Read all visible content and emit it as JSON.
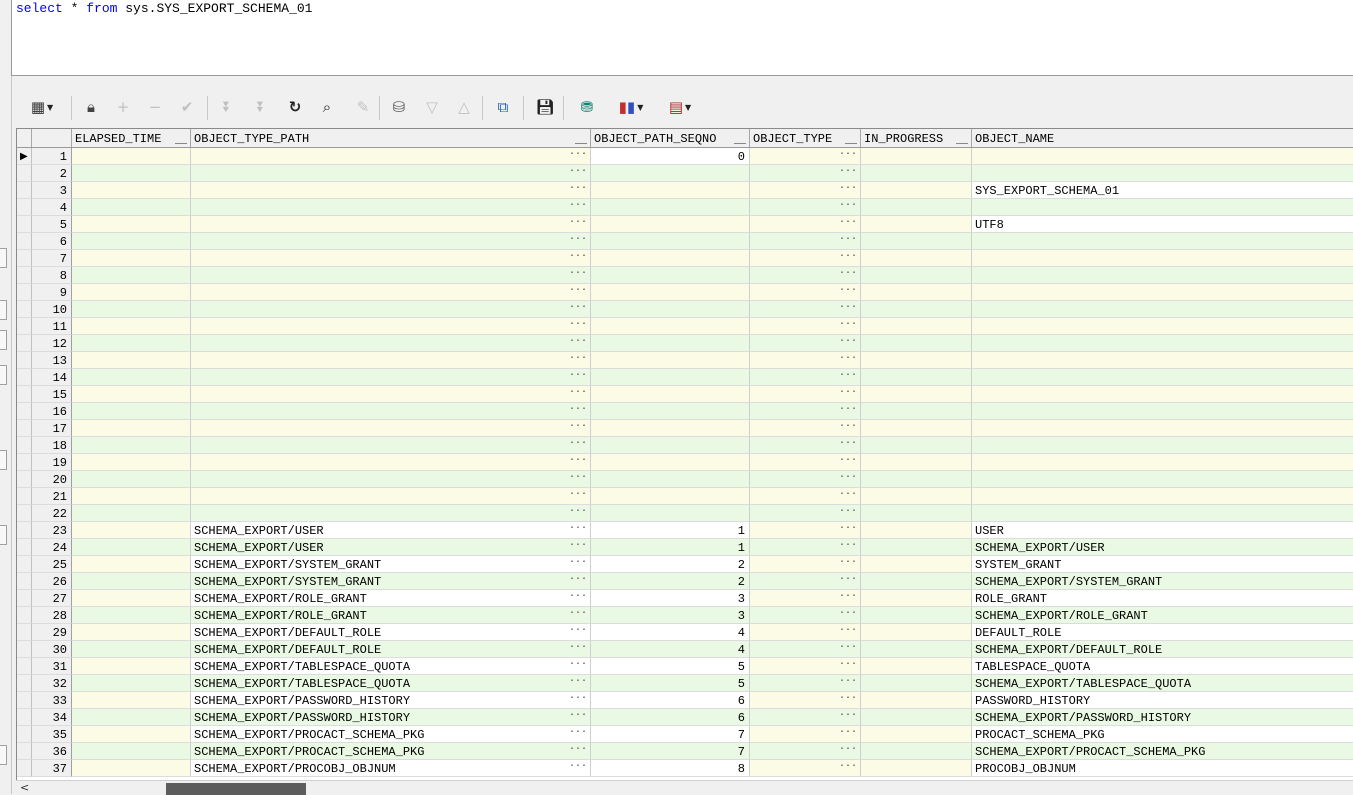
{
  "sql": {
    "keyword_select": "select",
    "star": " * ",
    "keyword_from": "from",
    "table_ref": " sys.SYS_EXPORT_SCHEMA_01"
  },
  "columns": [
    "ELAPSED_TIME",
    "OBJECT_TYPE_PATH",
    "OBJECT_PATH_SEQNO",
    "OBJECT_TYPE",
    "IN_PROGRESS",
    "OBJECT_NAME"
  ],
  "cell_ellipsis": "···",
  "rows": [
    {
      "n": "1",
      "path": "",
      "seq": "0",
      "name": ""
    },
    {
      "n": "2",
      "path": "",
      "seq": "",
      "name": ""
    },
    {
      "n": "3",
      "path": "",
      "seq": "",
      "name": "SYS_EXPORT_SCHEMA_01"
    },
    {
      "n": "4",
      "path": "",
      "seq": "",
      "name": ""
    },
    {
      "n": "5",
      "path": "",
      "seq": "",
      "name": "UTF8"
    },
    {
      "n": "6",
      "path": "",
      "seq": "",
      "name": ""
    },
    {
      "n": "7",
      "path": "",
      "seq": "",
      "name": ""
    },
    {
      "n": "8",
      "path": "",
      "seq": "",
      "name": ""
    },
    {
      "n": "9",
      "path": "",
      "seq": "",
      "name": ""
    },
    {
      "n": "10",
      "path": "",
      "seq": "",
      "name": ""
    },
    {
      "n": "11",
      "path": "",
      "seq": "",
      "name": ""
    },
    {
      "n": "12",
      "path": "",
      "seq": "",
      "name": ""
    },
    {
      "n": "13",
      "path": "",
      "seq": "",
      "name": ""
    },
    {
      "n": "14",
      "path": "",
      "seq": "",
      "name": ""
    },
    {
      "n": "15",
      "path": "",
      "seq": "",
      "name": ""
    },
    {
      "n": "16",
      "path": "",
      "seq": "",
      "name": ""
    },
    {
      "n": "17",
      "path": "",
      "seq": "",
      "name": ""
    },
    {
      "n": "18",
      "path": "",
      "seq": "",
      "name": ""
    },
    {
      "n": "19",
      "path": "",
      "seq": "",
      "name": ""
    },
    {
      "n": "20",
      "path": "",
      "seq": "",
      "name": ""
    },
    {
      "n": "21",
      "path": "",
      "seq": "",
      "name": ""
    },
    {
      "n": "22",
      "path": "",
      "seq": "",
      "name": ""
    },
    {
      "n": "23",
      "path": "SCHEMA_EXPORT/USER",
      "seq": "1",
      "name": "USER"
    },
    {
      "n": "24",
      "path": "SCHEMA_EXPORT/USER",
      "seq": "1",
      "name": "SCHEMA_EXPORT/USER"
    },
    {
      "n": "25",
      "path": "SCHEMA_EXPORT/SYSTEM_GRANT",
      "seq": "2",
      "name": "SYSTEM_GRANT"
    },
    {
      "n": "26",
      "path": "SCHEMA_EXPORT/SYSTEM_GRANT",
      "seq": "2",
      "name": "SCHEMA_EXPORT/SYSTEM_GRANT"
    },
    {
      "n": "27",
      "path": "SCHEMA_EXPORT/ROLE_GRANT",
      "seq": "3",
      "name": "ROLE_GRANT"
    },
    {
      "n": "28",
      "path": "SCHEMA_EXPORT/ROLE_GRANT",
      "seq": "3",
      "name": "SCHEMA_EXPORT/ROLE_GRANT"
    },
    {
      "n": "29",
      "path": "SCHEMA_EXPORT/DEFAULT_ROLE",
      "seq": "4",
      "name": "DEFAULT_ROLE"
    },
    {
      "n": "30",
      "path": "SCHEMA_EXPORT/DEFAULT_ROLE",
      "seq": "4",
      "name": "SCHEMA_EXPORT/DEFAULT_ROLE"
    },
    {
      "n": "31",
      "path": "SCHEMA_EXPORT/TABLESPACE_QUOTA",
      "seq": "5",
      "name": "TABLESPACE_QUOTA"
    },
    {
      "n": "32",
      "path": "SCHEMA_EXPORT/TABLESPACE_QUOTA",
      "seq": "5",
      "name": "SCHEMA_EXPORT/TABLESPACE_QUOTA"
    },
    {
      "n": "33",
      "path": "SCHEMA_EXPORT/PASSWORD_HISTORY",
      "seq": "6",
      "name": "PASSWORD_HISTORY"
    },
    {
      "n": "34",
      "path": "SCHEMA_EXPORT/PASSWORD_HISTORY",
      "seq": "6",
      "name": "SCHEMA_EXPORT/PASSWORD_HISTORY"
    },
    {
      "n": "35",
      "path": "SCHEMA_EXPORT/PROCACT_SCHEMA_PKG",
      "seq": "7",
      "name": "PROCACT_SCHEMA_PKG"
    },
    {
      "n": "36",
      "path": "SCHEMA_EXPORT/PROCACT_SCHEMA_PKG",
      "seq": "7",
      "name": "SCHEMA_EXPORT/PROCACT_SCHEMA_PKG"
    },
    {
      "n": "37",
      "path": "SCHEMA_EXPORT/PROCOBJ_OBJNUM",
      "seq": "8",
      "name": "PROCOBJ_OBJNUM"
    }
  ],
  "toolbar_icons": [
    "grid-view-icon",
    "lock-icon",
    "plus-icon",
    "minus-icon",
    "check-icon",
    "fetch-next-icon",
    "fetch-last-icon",
    "refresh-icon",
    "binoculars-icon",
    "eraser-icon",
    "query-by-example-icon",
    "triangle-down-icon",
    "triangle-up-icon",
    "explain-plan-icon",
    "save-icon",
    "export-icon",
    "chart-icon",
    "table-view-icon"
  ],
  "colors": {
    "row_light": "#fbfbe6",
    "row_alt": "#e9f9e4",
    "row_white": "#ffffff",
    "keyword": "#0000ff"
  }
}
